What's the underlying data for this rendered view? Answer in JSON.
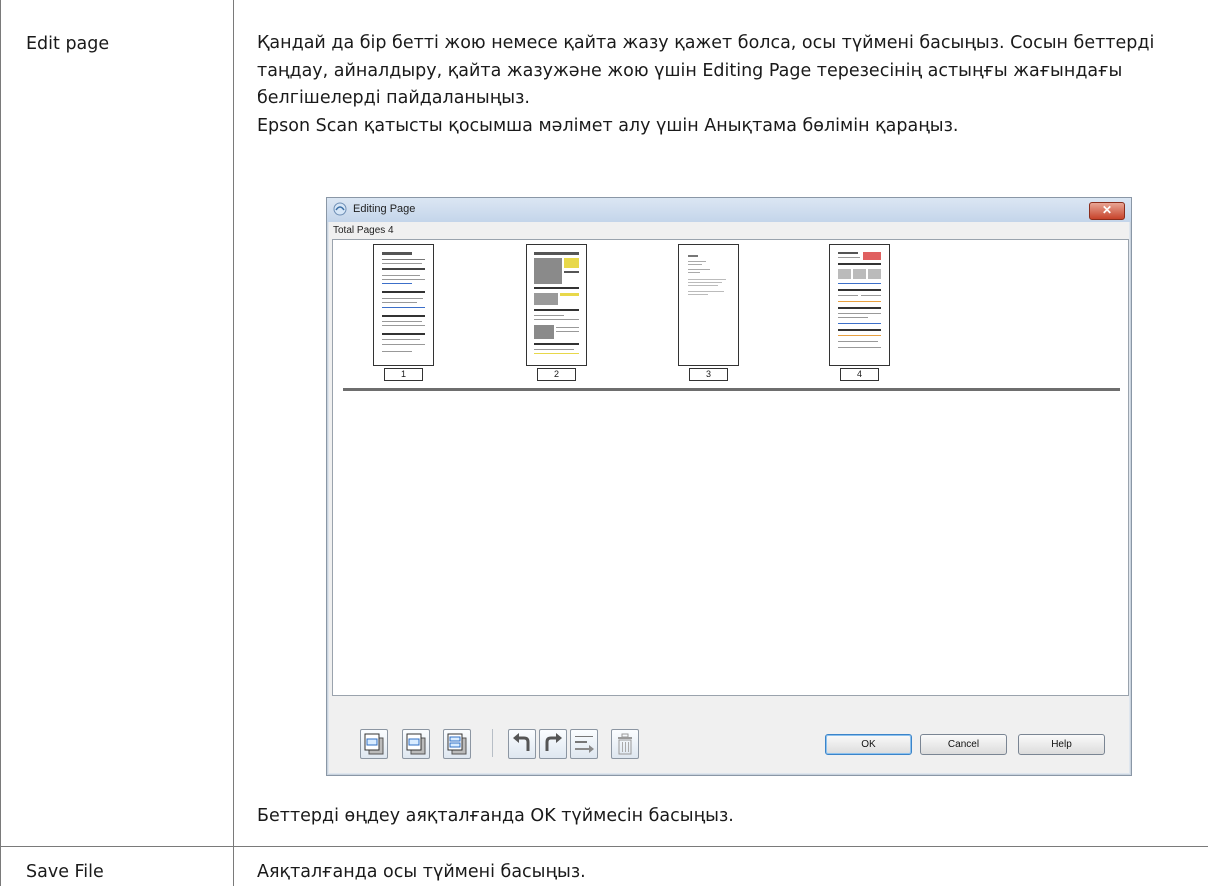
{
  "table": {
    "row1": {
      "label": "Edit page",
      "desc_p1": "Қандай да бір бетті жою немесе қайта жазу қажет болса, осы түймені басыңыз. Сосын беттерді таңдау, айналдыру, қайта жазужәне жою үшін Editing Page терезесінің астыңғы жағындағы белгішелерді пайдаланыңыз.",
      "desc_p2": "Epson Scan қатысты қосымша мәлімет алу үшін Анықтама бөлімін қараңыз.",
      "footer": "Беттерді өңдеу аяқталғанда OK түймесін басыңыз."
    },
    "row2": {
      "label": "Save File",
      "desc": "Аяқталғанда осы түймені басыңыз."
    }
  },
  "dialog": {
    "title": "Editing Page",
    "close_glyph": "✕",
    "total_pages": "Total Pages 4",
    "pages": [
      "1",
      "2",
      "3",
      "4"
    ],
    "buttons": {
      "ok": "OK",
      "cancel": "Cancel",
      "help": "Help"
    },
    "toolbar_icons": [
      "odd-pages-icon",
      "even-pages-icon",
      "all-pages-icon",
      "rotate-left-icon",
      "rotate-right-icon",
      "reorder-icon",
      "delete-icon"
    ]
  }
}
